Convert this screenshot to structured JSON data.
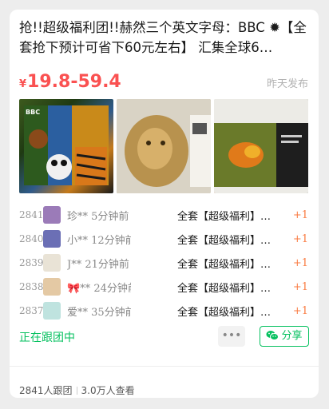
{
  "post": {
    "title": "抢!!超级福利团!!赫然三个英文字母：BBC ✹【全套抢下预计可省下60元左右】 汇集全球6…",
    "currency": "¥",
    "price_range": "19.8-59.4",
    "post_time": "昨天发布"
  },
  "images": [
    {
      "name": "product-image-1",
      "label": "BBC"
    },
    {
      "name": "product-image-2",
      "label": ""
    },
    {
      "name": "product-image-3",
      "label": ""
    }
  ],
  "records": [
    {
      "num": "2841",
      "name": "珍** 5分钟前",
      "item": "全套【超级福利】…",
      "qty": "+1",
      "avatar_color": "#9b7bb8"
    },
    {
      "num": "2840",
      "name": "小** 12分钟前",
      "item": "全套【超级福利】…",
      "qty": "+1",
      "avatar_color": "#6b6fb5"
    },
    {
      "num": "2839",
      "name": "J** 21分钟前",
      "item": "全套【超级福利】…",
      "qty": "+1",
      "avatar_color": "#8a9a6a"
    },
    {
      "num": "2838",
      "name": "🎀** 24分钟前",
      "item": "全套【超级福利】…",
      "qty": "+1",
      "avatar_color": "#c8a17a"
    },
    {
      "num": "2837",
      "name": "爱** 35分钟前",
      "item": "全套【超级福利】…",
      "qty": "+1",
      "avatar_color": "#4a8a8a"
    }
  ],
  "status": {
    "following": "正在跟团中"
  },
  "actions": {
    "more": "•••",
    "share": "分享"
  },
  "footer": {
    "joined": "2841人跟团",
    "views": "3.0万人查看"
  },
  "colors": {
    "price": "#fa5151",
    "accent_green": "#07c160",
    "plus_orange": "#fa7a40"
  }
}
